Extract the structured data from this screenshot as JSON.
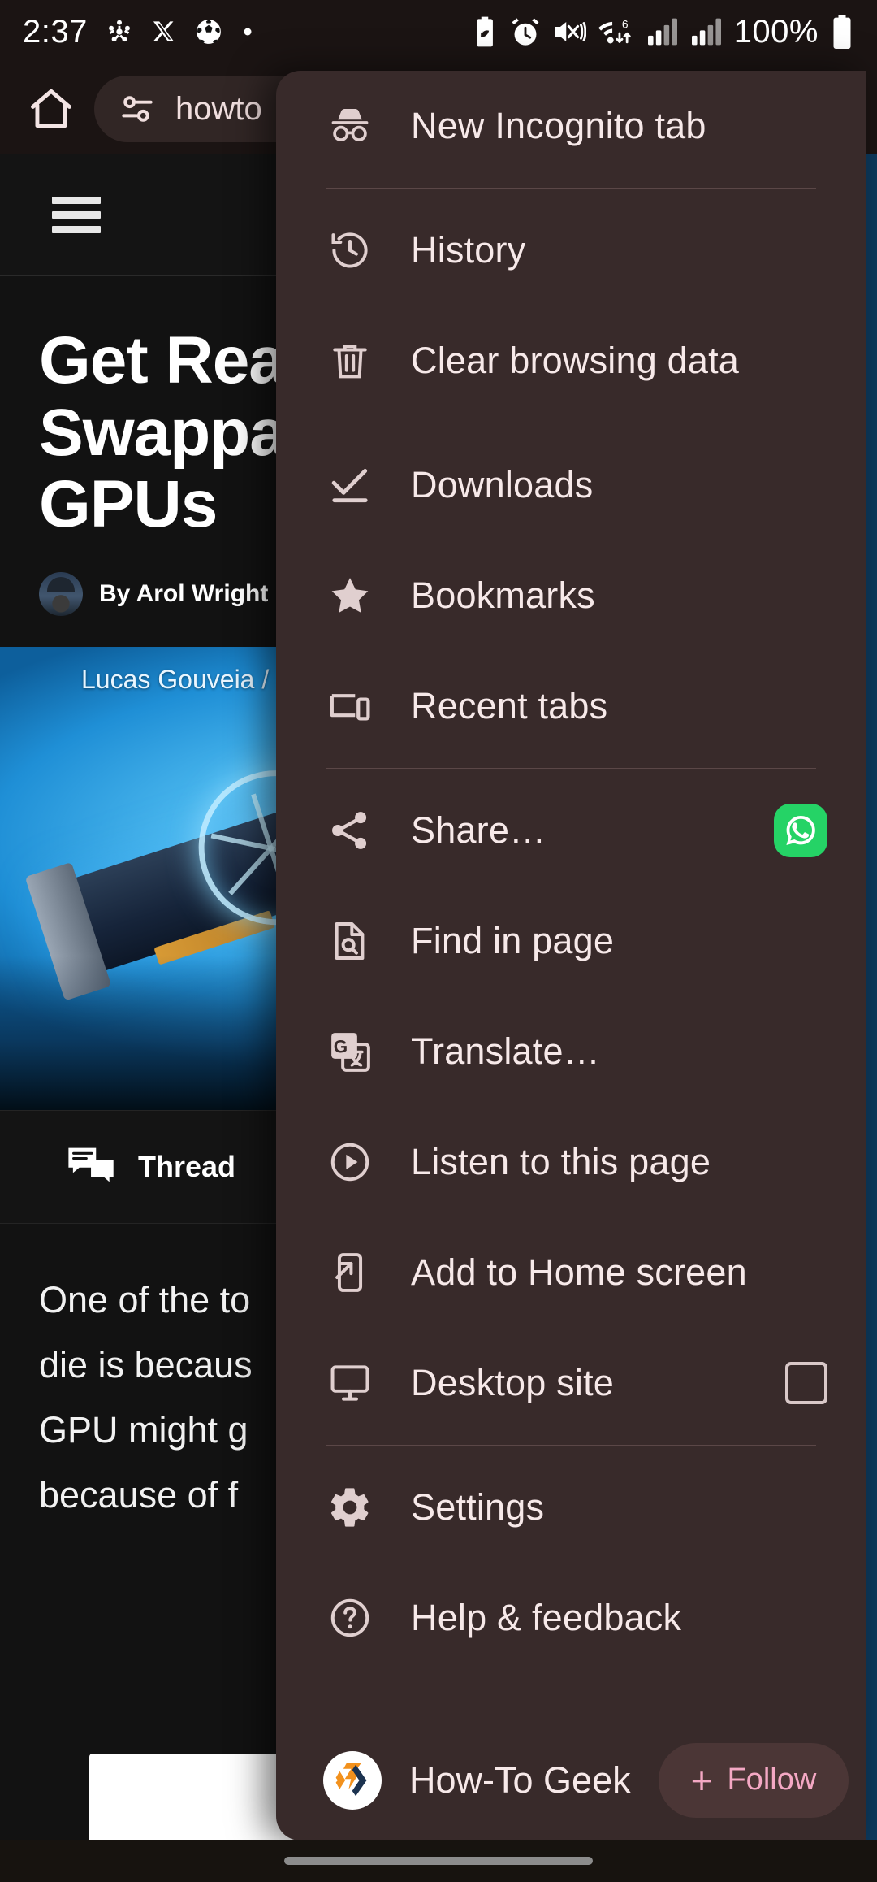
{
  "status_bar": {
    "time": "2:37",
    "battery_percent": "100%",
    "left_icons": [
      "bluetooth-share-icon",
      "x-twitter-icon",
      "football-icon",
      "dot-icon"
    ],
    "right_icons": [
      "battery-saver-icon",
      "alarm-icon",
      "mute-vibrate-icon",
      "wifi-6-icon",
      "signal-sim1-icon",
      "signal-sim2-icon",
      "battery-full-icon"
    ]
  },
  "toolbar": {
    "home_icon": "home-icon",
    "omnibox": {
      "lock_icon": "site-settings-tune-icon",
      "url_text": "howto"
    }
  },
  "page": {
    "hamburger_icon": "hamburger-menu-icon",
    "headline_lines": [
      "Get Rea",
      "Swappa",
      "GPUs"
    ],
    "byline": "By Arol Wright",
    "byline_suffix": "-",
    "hero_credit": "Lucas Gouveia /",
    "thread_label": "Thread",
    "thread_icon": "comment-thread-icon",
    "body_lines": [
      "One of the to",
      "die is becaus",
      "GPU might g",
      "because of f"
    ]
  },
  "menu": {
    "groups": [
      {
        "items": [
          {
            "icon": "incognito-icon",
            "label": "New Incognito tab",
            "trailing": null
          }
        ]
      },
      {
        "items": [
          {
            "icon": "history-icon",
            "label": "History",
            "trailing": null
          },
          {
            "icon": "trash-icon",
            "label": "Clear browsing data",
            "trailing": null
          }
        ]
      },
      {
        "items": [
          {
            "icon": "download-check-icon",
            "label": "Downloads",
            "trailing": null
          },
          {
            "icon": "star-icon",
            "label": "Bookmarks",
            "trailing": null
          },
          {
            "icon": "recent-tabs-icon",
            "label": "Recent tabs",
            "trailing": null
          }
        ]
      },
      {
        "items": [
          {
            "icon": "share-icon",
            "label": "Share…",
            "trailing": "whatsapp-icon"
          },
          {
            "icon": "find-in-page-icon",
            "label": "Find in page",
            "trailing": null
          },
          {
            "icon": "google-translate-icon",
            "label": "Translate…",
            "trailing": null
          },
          {
            "icon": "play-circle-icon",
            "label": "Listen to this page",
            "trailing": null
          },
          {
            "icon": "add-to-home-screen-icon",
            "label": "Add to Home screen",
            "trailing": null
          },
          {
            "icon": "desktop-monitor-icon",
            "label": "Desktop site",
            "trailing": "checkbox-unchecked"
          }
        ]
      },
      {
        "items": [
          {
            "icon": "gear-icon",
            "label": "Settings",
            "trailing": null
          },
          {
            "icon": "help-circle-icon",
            "label": "Help & feedback",
            "trailing": null
          }
        ]
      }
    ],
    "footer": {
      "site_logo_icon": "how-to-geek-logo-icon",
      "site_name": "How-To Geek",
      "follow_plus": "+",
      "follow_label": "Follow"
    }
  },
  "colors": {
    "menu_bg": "#382a2a",
    "menu_text": "#f7e9e9",
    "accent_pink": "#f4a8c4",
    "whatsapp_green": "#25D366",
    "status_bg": "#1b1413",
    "page_bg": "#121212"
  }
}
